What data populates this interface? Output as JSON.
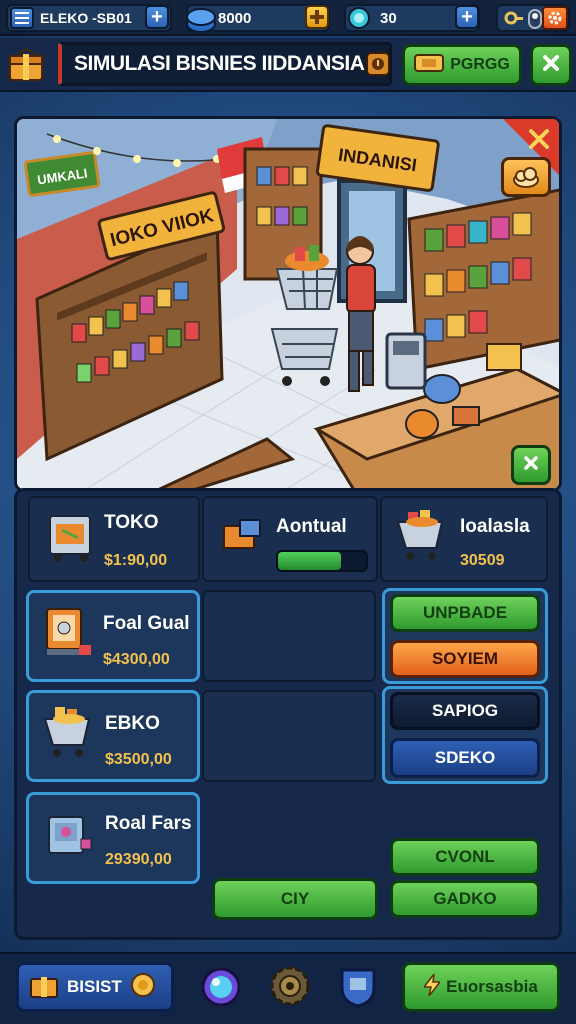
{
  "top_bar": {
    "profile_label": "ELEKO ‑SB01",
    "coins_value": "8000",
    "gems_value": "30"
  },
  "header": {
    "title": "SIMULASI BISNIES IIDDANSIA",
    "right_button_label": "PGRGG"
  },
  "scene": {
    "top_left_sign": "UMKALI",
    "shelf_sign": "IOKO VIIOK",
    "store_sign": "INDANISI"
  },
  "cards": [
    {
      "label": "TOKO",
      "price": "$1:90,00"
    },
    {
      "label": "Aontual",
      "progress": 0.72
    },
    {
      "label": "Ioalasla",
      "price": "30509"
    },
    {
      "label": "Foal Gual",
      "price": "$4300,00"
    },
    {
      "label": "EBKO",
      "price": "$3500,00"
    },
    {
      "label": "Roal Fars",
      "price": "29390,00"
    }
  ],
  "action_buttons": {
    "upgrade": "UNPBADE",
    "sotem": "SOYIEM",
    "sapiog": "SAPIOG",
    "sdeko": "SDEKO",
    "cvonl": "CVONL",
    "gadko": "GADKO",
    "ciy": "CIY"
  },
  "bottom_bar": {
    "left_button_label": "BISIST",
    "right_button_label": "Euorsasbia"
  },
  "colors": {
    "accent_green": "#3fa93a",
    "accent_orange": "#ef7a25",
    "card_border": "#3a9bd9",
    "price_yellow": "#f2c14e",
    "background": "#1b3a63"
  }
}
